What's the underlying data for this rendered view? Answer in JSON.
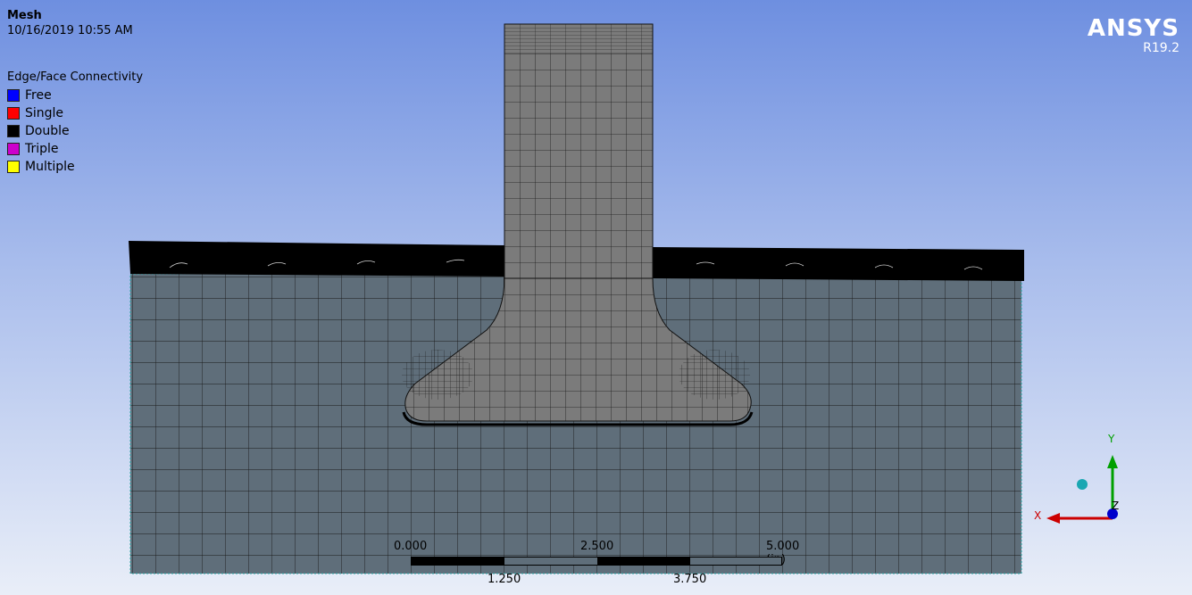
{
  "header": {
    "title": "Mesh",
    "timestamp": "10/16/2019 10:55 AM"
  },
  "legend": {
    "title": "Edge/Face Connectivity",
    "items": [
      {
        "label": "Free",
        "color": "#0000ff"
      },
      {
        "label": "Single",
        "color": "#ff0000"
      },
      {
        "label": "Double",
        "color": "#000000"
      },
      {
        "label": "Triple",
        "color": "#cc00cc"
      },
      {
        "label": "Multiple",
        "color": "#ffff00"
      }
    ]
  },
  "brand": {
    "name": "ANSYS",
    "version": "R19.2"
  },
  "scale_bar": {
    "top_labels": [
      "0.000",
      "2.500",
      "5.000 (in)"
    ],
    "bottom_labels": [
      "1.250",
      "3.750"
    ]
  },
  "triad": {
    "y_label": "Y",
    "x_label": "X",
    "z_label": "Z",
    "colors": {
      "x": "#cc0000",
      "y": "#00a000",
      "z": "#0000cc"
    }
  },
  "mesh_colors": {
    "block": "#5f6e7a",
    "stem": "#7b7b7b",
    "edge": "#1a1a1a",
    "top_band": "#000000"
  }
}
